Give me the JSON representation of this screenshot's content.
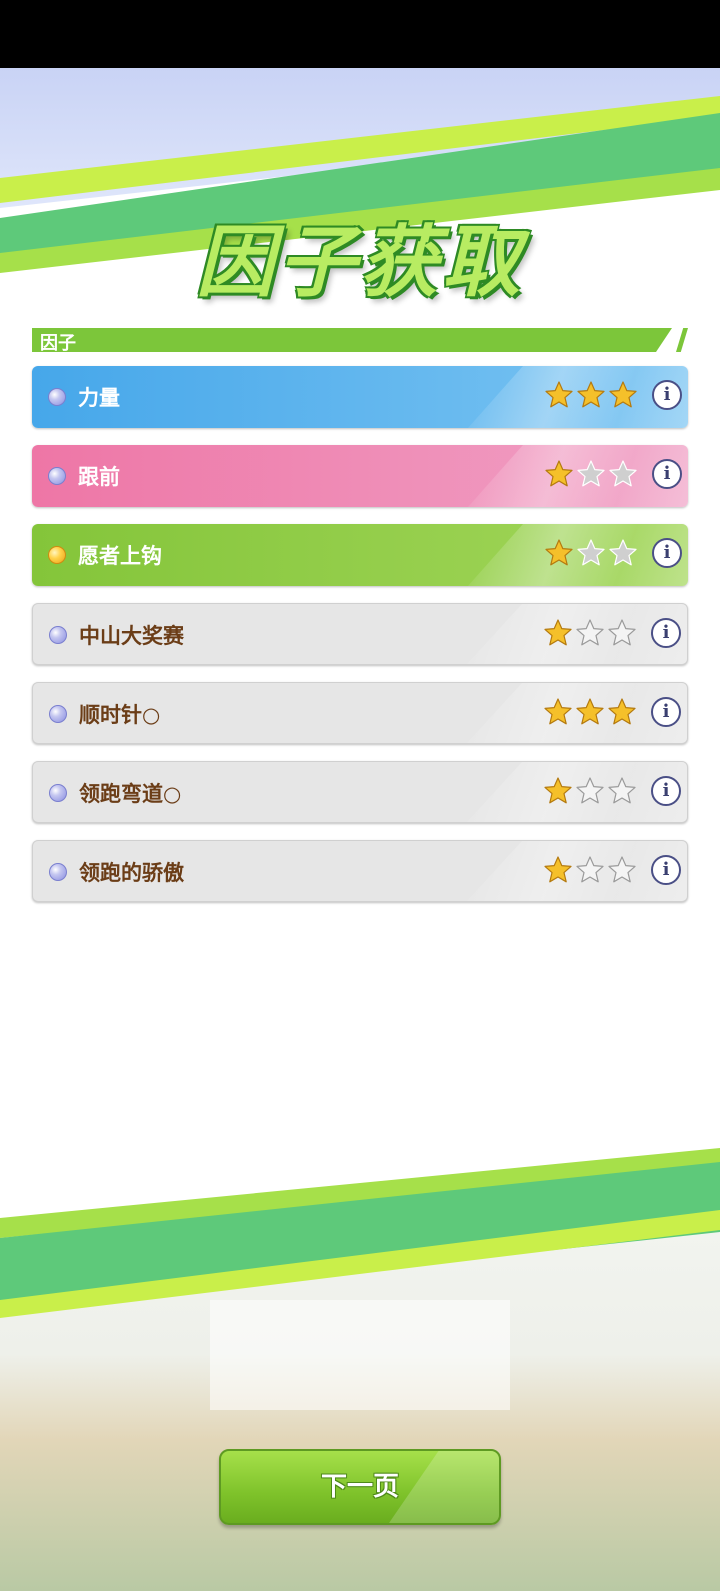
{
  "title": "因子获取",
  "section_label": "因子",
  "factors": [
    {
      "name": "力量",
      "stars": 3,
      "style": "blue",
      "gem": "blue-gem"
    },
    {
      "name": "跟前",
      "stars": 1,
      "style": "pink",
      "gem": "blue-gem"
    },
    {
      "name": "愿者上钩",
      "stars": 1,
      "style": "green",
      "gem": "gold-gem"
    },
    {
      "name": "中山大奖赛",
      "stars": 1,
      "style": "gray",
      "gem": "blue-gem"
    },
    {
      "name": "顺时针○",
      "stars": 3,
      "style": "gray",
      "gem": "blue-gem"
    },
    {
      "name": "领跑弯道○",
      "stars": 1,
      "style": "gray",
      "gem": "blue-gem"
    },
    {
      "name": "领跑的骄傲",
      "stars": 1,
      "style": "gray",
      "gem": "blue-gem"
    }
  ],
  "max_stars": 3,
  "info_glyph": "i",
  "next_button_label": "下一页",
  "colors": {
    "title_fill": "#b8ec62",
    "title_outline": "#2e8a24",
    "blue_row": "#46a7ea",
    "pink_row": "#ee76a6",
    "green_row": "#84c53a",
    "gray_row": "#e6e6e6",
    "gray_row_text": "#6b3d17",
    "star_gold": "#f5c02a",
    "stripe_lime": "#c9ef4a",
    "stripe_green": "#5ec97a"
  }
}
